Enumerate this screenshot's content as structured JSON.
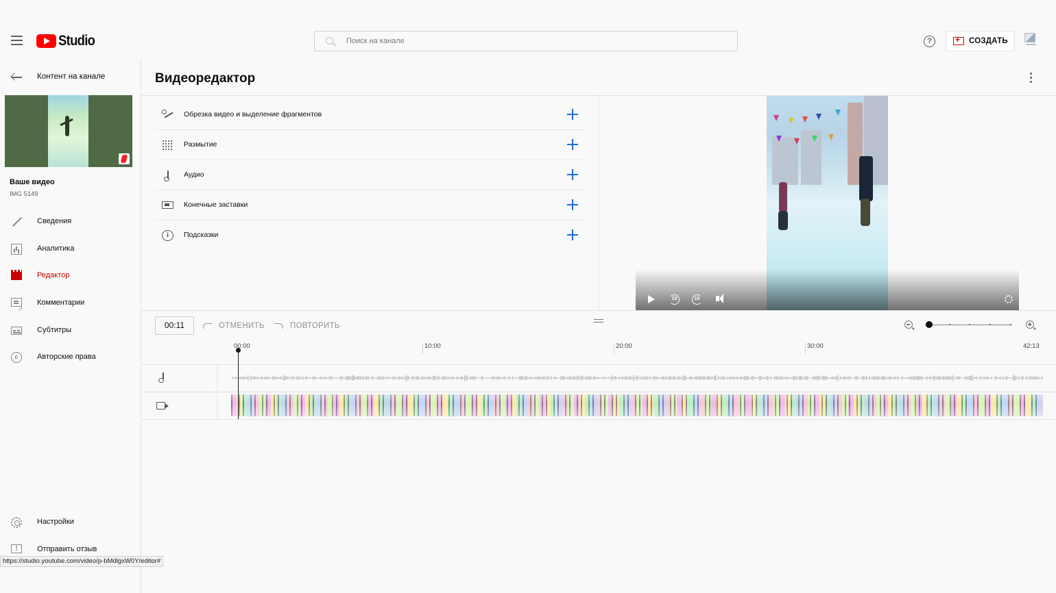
{
  "header": {
    "logo_text": "Studio",
    "search_placeholder": "Поиск на канале",
    "help_symbol": "?",
    "create_label": "СОЗДАТЬ"
  },
  "sidebar": {
    "back_label": "Контент на канале",
    "video_heading": "Ваше видео",
    "video_filename": "IMG 5149",
    "items": [
      {
        "label": "Сведения",
        "icon": "pencil-icon",
        "active": false
      },
      {
        "label": "Аналитика",
        "icon": "analytics-icon",
        "active": false
      },
      {
        "label": "Редактор",
        "icon": "clapperboard-icon",
        "active": true
      },
      {
        "label": "Комментарии",
        "icon": "comment-icon",
        "active": false
      },
      {
        "label": "Субтитры",
        "icon": "subtitles-icon",
        "active": false
      },
      {
        "label": "Авторские права",
        "icon": "copyright-icon",
        "active": false
      }
    ],
    "footer_items": [
      {
        "label": "Настройки",
        "icon": "gear-icon"
      },
      {
        "label": "Отправить отзыв",
        "icon": "feedback-icon"
      }
    ]
  },
  "editor": {
    "title": "Видеоредактор",
    "tools": [
      {
        "label": "Обрезка видео и выделение фрагментов",
        "icon": "scissors-icon"
      },
      {
        "label": "Размытие",
        "icon": "blur-icon"
      },
      {
        "label": "Аудио",
        "icon": "music-note-icon"
      },
      {
        "label": "Конечные заставки",
        "icon": "end-screen-icon"
      },
      {
        "label": "Подсказки",
        "icon": "info-icon"
      }
    ],
    "current_time": "00:11",
    "undo_label": "ОТМЕНИТЬ",
    "redo_label": "ПОВТОРИТЬ",
    "ruler_ticks": [
      "00:00",
      "10:00",
      "20:00",
      "30:00",
      "42:13"
    ],
    "player_controls": {
      "rewind_label": "10",
      "forward_label": "10"
    }
  },
  "status_bar": {
    "url": "https://studio.youtube.com/video/p-bMdlgxW0Y/editor#"
  },
  "colors": {
    "accent_red": "#cc0000",
    "plus_blue": "#1a6fd8",
    "logo_red": "#ff0000"
  }
}
